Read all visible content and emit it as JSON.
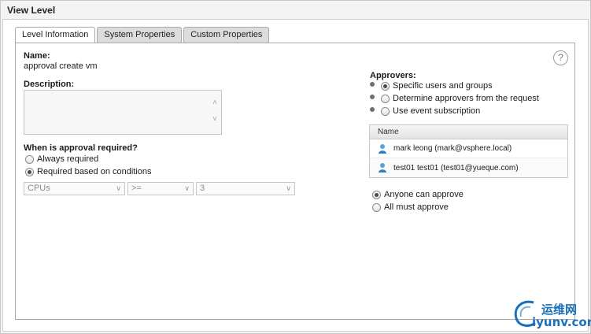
{
  "window": {
    "title": "View Level"
  },
  "tabs": [
    {
      "label": "Level Information",
      "active": true
    },
    {
      "label": "System Properties",
      "active": false
    },
    {
      "label": "Custom Properties",
      "active": false
    }
  ],
  "level": {
    "name_label": "Name:",
    "name_value": "approval create vm",
    "description_label": "Description:",
    "description_value": ""
  },
  "approval": {
    "question": "When is approval required?",
    "options": [
      {
        "label": "Always required",
        "checked": false
      },
      {
        "label": "Required based on conditions",
        "checked": true
      }
    ],
    "condition": {
      "field": "CPUs",
      "operator": ">=",
      "value": "3"
    }
  },
  "help": {
    "glyph": "?"
  },
  "approvers": {
    "label": "Approvers:",
    "options": [
      {
        "label": "Specific users and groups",
        "checked": true
      },
      {
        "label": "Determine approvers from the request",
        "checked": false
      },
      {
        "label": "Use event subscription",
        "checked": false
      }
    ],
    "table_header": "Name",
    "rows": [
      {
        "name": "mark leong (mark@vsphere.local)",
        "icon": "user-icon"
      },
      {
        "name": "test01 test01 (test01@yueque.com)",
        "icon": "user-icon"
      }
    ],
    "mode_options": [
      {
        "label": "Anyone can approve",
        "checked": true
      },
      {
        "label": "All must approve",
        "checked": false
      }
    ]
  },
  "watermark": {
    "brand_cn": "运维网",
    "domain": "iyunv.com"
  },
  "colors": {
    "accent": "#1a6fb8",
    "panel_bg": "#f3f3f3",
    "border": "#a9a9a9"
  }
}
